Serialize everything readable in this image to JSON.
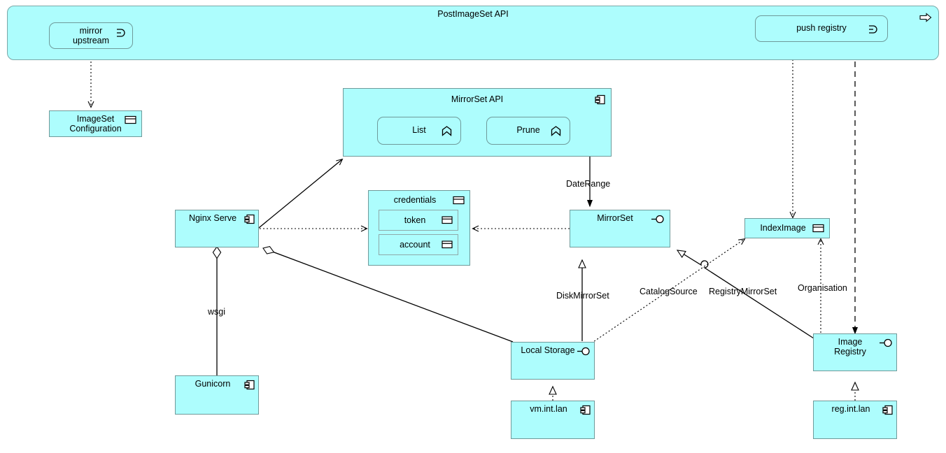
{
  "diagram": {
    "type": "uml-component-diagram",
    "background": "#ffffff",
    "node_fill": "#adfdfd",
    "node_stroke": "#6f9a9a",
    "line_color": "#000000"
  },
  "containers": [
    {
      "id": "postimageset-api",
      "label": "PostImageSet API",
      "icon": "process-arrow-icon"
    }
  ],
  "nodes": {
    "mirror_upstream": {
      "label_line1": "mirror",
      "label_line2": "upstream",
      "icon": "interface-use-case-icon"
    },
    "push_registry": {
      "label": "push registry",
      "icon": "interface-use-case-icon"
    },
    "imageset_configuration": {
      "label_line1": "ImageSet",
      "label_line2": "Configuration",
      "icon": "node-rect-icon"
    },
    "mirrorset_api": {
      "label": "MirrorSet API",
      "icon": "component-icon"
    },
    "list": {
      "label": "List",
      "icon": "chevron-up-icon"
    },
    "prune": {
      "label": "Prune",
      "icon": "chevron-up-icon"
    },
    "nginx_serve": {
      "label": "Nginx Serve",
      "icon": "component-icon"
    },
    "credentials": {
      "label": "credentials",
      "icon": "node-rect-icon"
    },
    "token": {
      "label": "token",
      "icon": "node-rect-icon"
    },
    "account": {
      "label": "account",
      "icon": "node-rect-icon"
    },
    "mirrorset": {
      "label": "MirrorSet",
      "icon": "lollipop-interface-icon"
    },
    "indeximage": {
      "label": "IndexImage",
      "icon": "node-rect-icon"
    },
    "gunicorn": {
      "label": "Gunicorn",
      "icon": "component-icon"
    },
    "local_storage": {
      "label": "Local Storage",
      "icon": "lollipop-interface-icon"
    },
    "vm_int_lan": {
      "label": "vm.int.lan",
      "icon": "component-icon"
    },
    "image_registry": {
      "label_line1": "Image",
      "label_line2": "Registry",
      "icon": "lollipop-interface-icon"
    },
    "reg_int_lan": {
      "label": "reg.int.lan",
      "icon": "component-icon"
    }
  },
  "edge_labels": {
    "daterange": "DateRange",
    "diskmirrorset": "DiskMirrorSet",
    "catalogsource": "CatalogSource",
    "registrymirrorset": "RegistryMirrorSet",
    "organisation": "Organisation",
    "wsgi": "wsgi"
  },
  "edges": [
    {
      "from": "mirror_upstream",
      "to": "push_registry",
      "style": "dashed",
      "arrow": "filled"
    },
    {
      "from": "mirror_upstream",
      "to": "imageset_configuration",
      "style": "dotted",
      "arrow": "open"
    },
    {
      "from": "nginx_serve",
      "to": "mirrorset_api",
      "style": "solid",
      "arrow": "open"
    },
    {
      "from": "nginx_serve",
      "to": "credentials",
      "style": "dotted",
      "arrow": "open"
    },
    {
      "from": "mirrorset",
      "to": "credentials",
      "style": "dotted",
      "arrow": "open"
    },
    {
      "from": "mirrorset_api",
      "to": "mirrorset",
      "style": "solid",
      "arrow": "filled",
      "label": "DateRange"
    },
    {
      "from": "local_storage",
      "to": "mirrorset",
      "style": "solid",
      "arrow": "hollow-triangle",
      "label": "DiskMirrorSet"
    },
    {
      "from": "local_storage",
      "to": "indeximage",
      "style": "dotted",
      "arrow": "open",
      "label": "CatalogSource"
    },
    {
      "from": "image_registry",
      "to": "mirrorset",
      "style": "solid",
      "arrow": "hollow-triangle",
      "label": "RegistryMirrorSet"
    },
    {
      "from": "image_registry",
      "to": "indeximage",
      "style": "dotted",
      "arrow": "open",
      "label": "Organisation"
    },
    {
      "from": "push_registry",
      "to": "indeximage",
      "style": "dotted",
      "arrow": "open"
    },
    {
      "from": "push_registry",
      "to": "image_registry",
      "style": "dashed",
      "arrow": "filled"
    },
    {
      "from": "nginx_serve",
      "to": "gunicorn",
      "style": "solid",
      "arrow": "aggregation-diamond",
      "label": "wsgi"
    },
    {
      "from": "nginx_serve",
      "to": "local_storage",
      "style": "solid",
      "arrow": "aggregation-diamond"
    },
    {
      "from": "vm_int_lan",
      "to": "local_storage",
      "style": "dotted",
      "arrow": "hollow-triangle"
    },
    {
      "from": "reg_int_lan",
      "to": "image_registry",
      "style": "dotted",
      "arrow": "hollow-triangle"
    }
  ]
}
